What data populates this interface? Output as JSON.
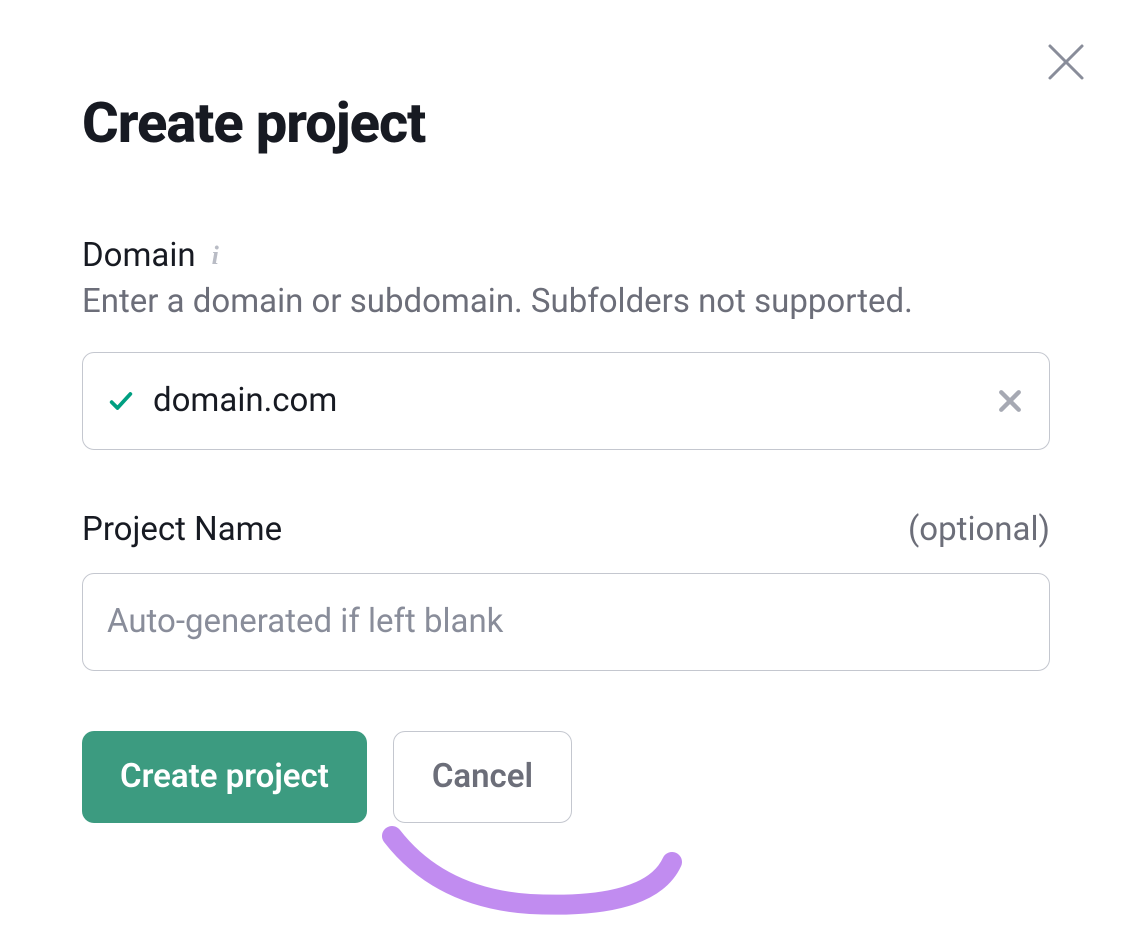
{
  "modal": {
    "title": "Create project",
    "close_label": "Close"
  },
  "domain": {
    "label": "Domain",
    "helper": "Enter a domain or subdomain. Subfolders not supported.",
    "value": "domain.com",
    "validated": true
  },
  "project_name": {
    "label": "Project Name",
    "optional_text": "(optional)",
    "placeholder": "Auto-generated if left blank",
    "value": ""
  },
  "actions": {
    "primary": "Create project",
    "secondary": "Cancel"
  },
  "colors": {
    "primary_button": "#3c9b80",
    "text_dark": "#171a22",
    "text_muted": "#6c6e79",
    "border": "#c4c7cf",
    "success": "#009f81",
    "annotation": "#c18cf0"
  }
}
